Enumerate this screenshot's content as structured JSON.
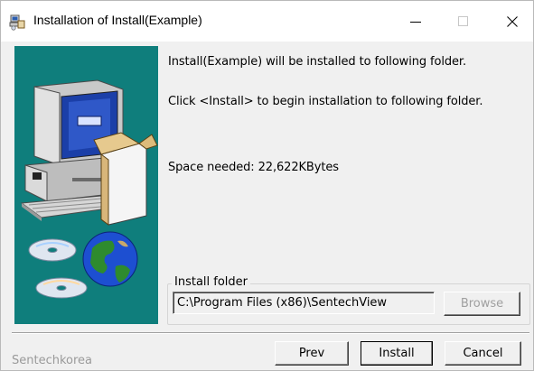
{
  "window": {
    "title": "Installation of Install(Example)",
    "controls": [
      "minimize-icon",
      "maximize-icon",
      "close-icon"
    ]
  },
  "messages": {
    "line1": "Install(Example) will be installed to following folder.",
    "line2": "Click <Install> to begin installation to following folder.",
    "space_needed": "Space needed: 22,622KBytes"
  },
  "install_folder": {
    "label": "Install folder",
    "path": "C:\\Program Files (x86)\\SentechView",
    "browse_label": "Browse"
  },
  "buttons": {
    "prev": "Prev",
    "install": "Install",
    "cancel": "Cancel"
  },
  "footer": {
    "brand": "Sentechkorea"
  },
  "colors": {
    "art_background": "#0f7e7c",
    "window_background": "#f0f0f0"
  },
  "icons": {
    "title": "installer-icon",
    "art": "computer-and-globe-illustration"
  }
}
